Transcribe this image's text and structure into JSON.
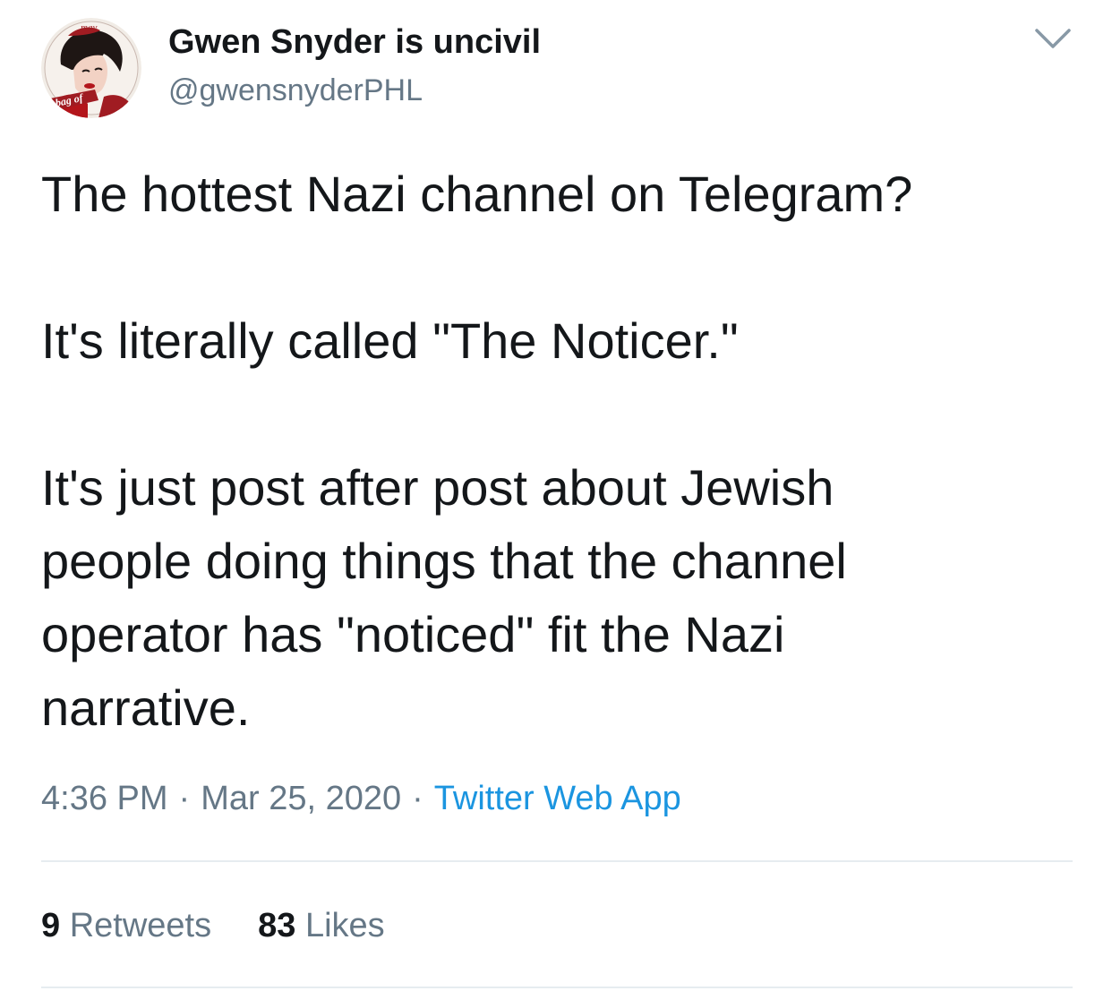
{
  "user": {
    "display_name": "Gwen Snyder is uncivil",
    "handle": "@gwensnyderPHL",
    "avatar_text_top": "may",
    "avatar_text_bottom": "a bag of"
  },
  "tweet": {
    "paragraphs": [
      "The hottest Nazi channel on Telegram?",
      "It's literally called \"The Noticer.\"",
      "It's just post after post about Jewish\npeople doing things that the channel\noperator has \"noticed\" fit the Nazi\nnarrative."
    ],
    "time": "4:36 PM",
    "separator": "·",
    "date": "Mar 25, 2020",
    "source": "Twitter Web App"
  },
  "stats": {
    "retweets_count": "9",
    "retweets_label": "Retweets",
    "likes_count": "83",
    "likes_label": "Likes"
  },
  "icons": {
    "caret": "chevron-down-icon",
    "avatar": "avatar-image"
  },
  "colors": {
    "text": "#14171a",
    "secondary": "#657786",
    "link": "#1b95e0",
    "divider": "#e6ecf0"
  }
}
